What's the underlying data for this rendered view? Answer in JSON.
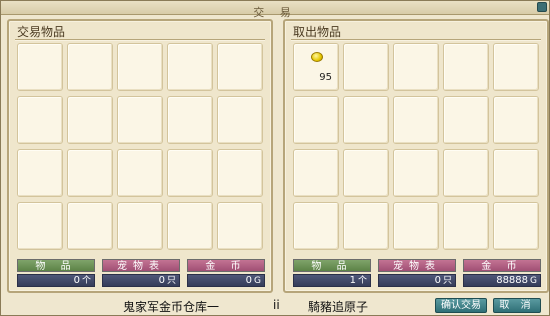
{
  "window": {
    "title": "交 易"
  },
  "left_panel": {
    "title": "交易物品",
    "slots": [
      "",
      "",
      "",
      "",
      "",
      "",
      "",
      "",
      "",
      "",
      "",
      "",
      "",
      "",
      "",
      "",
      "",
      "",
      "",
      ""
    ],
    "labels": {
      "items": "物 品",
      "pets": "宠物表",
      "gold": "金 币"
    },
    "values": {
      "items": "0",
      "items_unit": "个",
      "pets": "0",
      "pets_unit": "只",
      "gold": "0",
      "gold_unit": "G"
    }
  },
  "right_panel": {
    "title": "取出物品",
    "first_slot": {
      "icon": "gold-coin-icon",
      "count": "95"
    },
    "labels": {
      "items": "物 品",
      "pets": "宠物表",
      "gold": "金 币"
    },
    "values": {
      "items": "1",
      "items_unit": "个",
      "pets": "0",
      "pets_unit": "只",
      "gold": "88888",
      "gold_unit": "G"
    }
  },
  "footer": {
    "left_player": "鬼家军金币仓库一",
    "separator": "ii",
    "right_player": "騎豬追原子",
    "confirm_label": "确认交易",
    "cancel_label": "取 消"
  }
}
